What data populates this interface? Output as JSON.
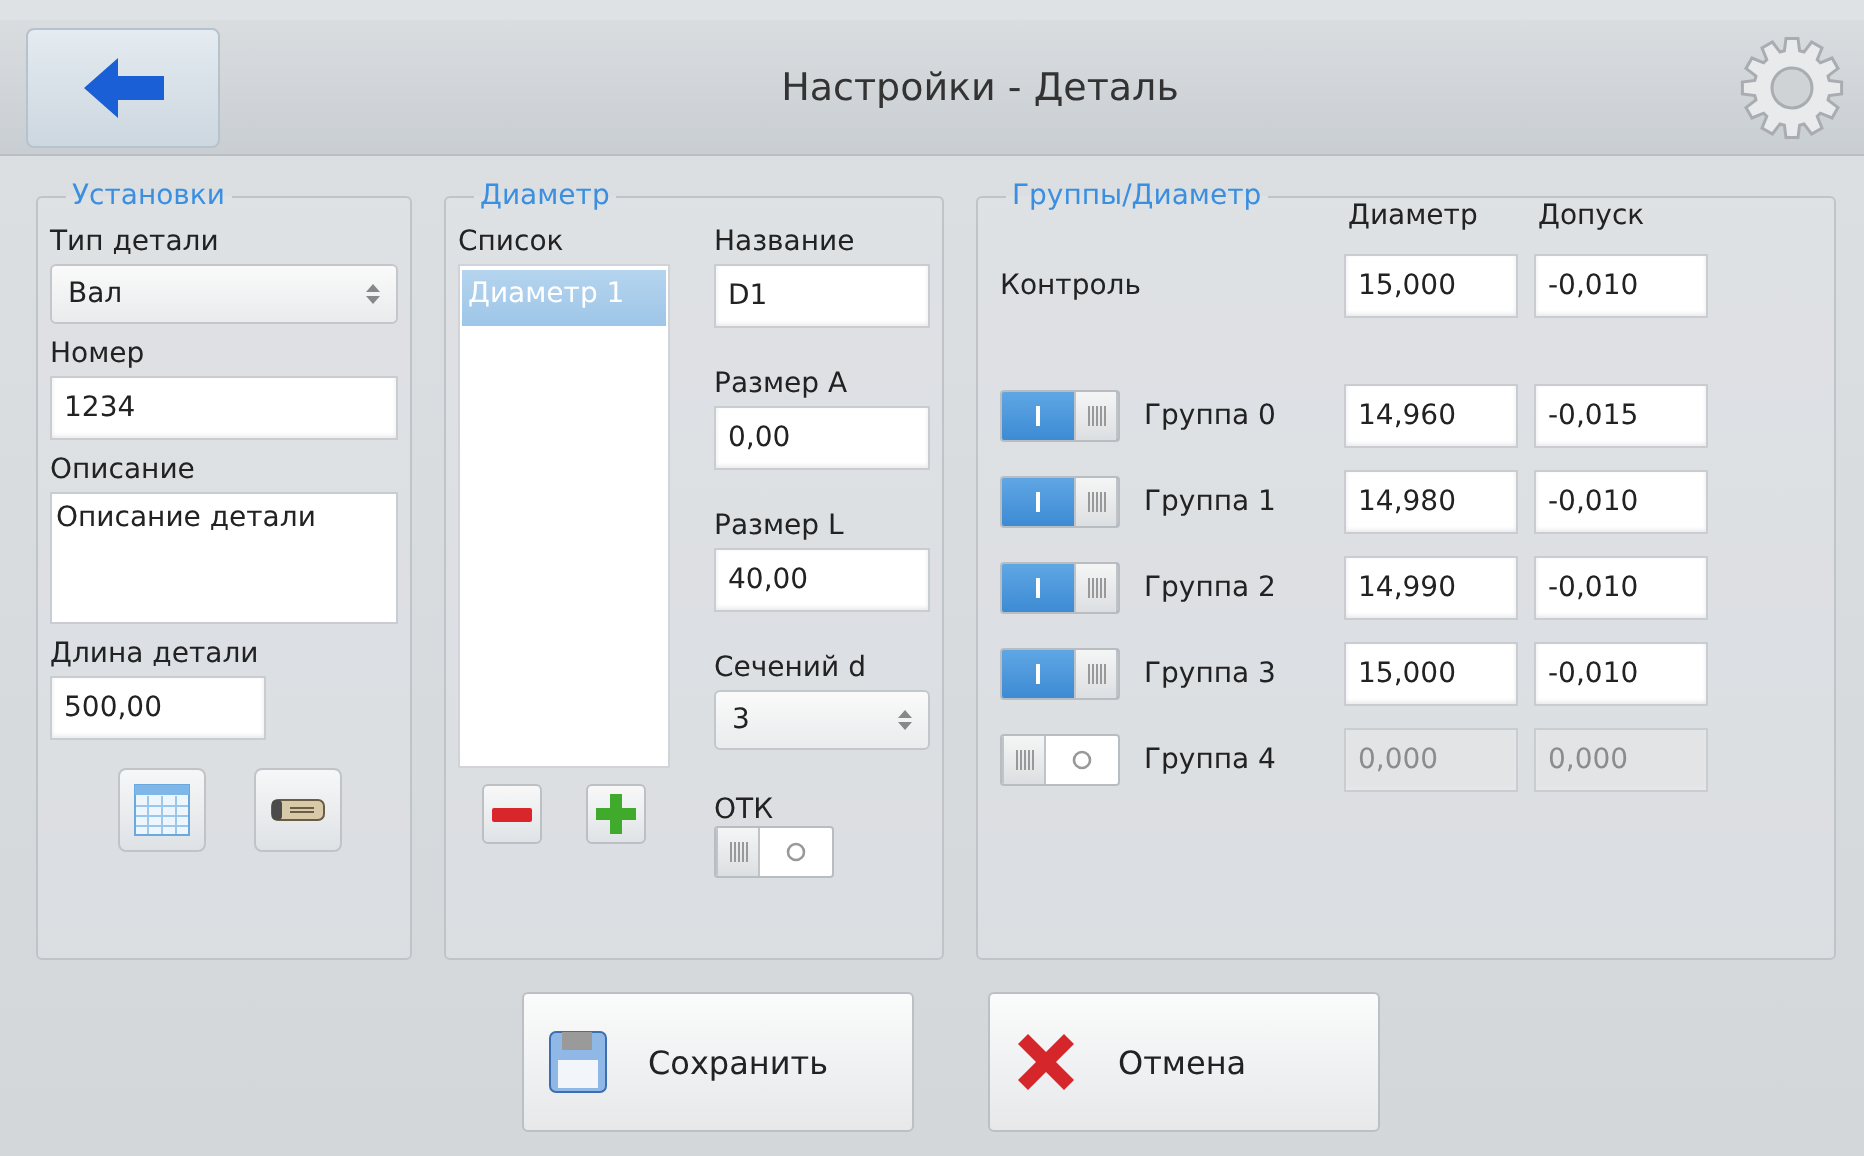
{
  "header": {
    "title": "Настройки - Деталь"
  },
  "settings": {
    "legend": "Установки",
    "fields": [
      {
        "label": "Тип детали",
        "kind": "select",
        "value": "Вал"
      },
      {
        "label": "Номер",
        "kind": "input",
        "value": "1234"
      },
      {
        "label": "Описание",
        "kind": "textarea",
        "value": "Описание детали"
      },
      {
        "label": "Длина детали",
        "kind": "short",
        "value": "500,00"
      }
    ]
  },
  "diameter": {
    "legend": "Диаметр",
    "list_label": "Список",
    "list": [
      {
        "label": "Диаметр 1",
        "selected": true
      }
    ],
    "fields": [
      {
        "label": "Название",
        "kind": "input",
        "value": "D1"
      },
      {
        "label": "Размер A",
        "kind": "input",
        "value": "0,00"
      },
      {
        "label": "Размер L",
        "kind": "input",
        "value": "40,00"
      },
      {
        "label": "Сечений d",
        "kind": "select",
        "value": "3"
      }
    ],
    "otk": {
      "label": "ОТК",
      "on": false
    }
  },
  "groups": {
    "legend": "Группы/Диаметр",
    "columns": [
      "Диаметр",
      "Допуск"
    ],
    "control": {
      "label": "Контроль",
      "diameter": "15,000",
      "tolerance": "-0,010"
    },
    "rows": [
      {
        "label": "Группа 0",
        "on": true,
        "diameter": "14,960",
        "tolerance": "-0,015"
      },
      {
        "label": "Группа 1",
        "on": true,
        "diameter": "14,980",
        "tolerance": "-0,010"
      },
      {
        "label": "Группа 2",
        "on": true,
        "diameter": "14,990",
        "tolerance": "-0,010"
      },
      {
        "label": "Группа 3",
        "on": true,
        "diameter": "15,000",
        "tolerance": "-0,010"
      },
      {
        "label": "Группа 4",
        "on": false,
        "diameter": "0,000",
        "tolerance": "0,000"
      }
    ]
  },
  "buttons": [
    {
      "label": "Сохранить",
      "kind": "save"
    },
    {
      "label": "Отмена",
      "kind": "cancel"
    }
  ]
}
